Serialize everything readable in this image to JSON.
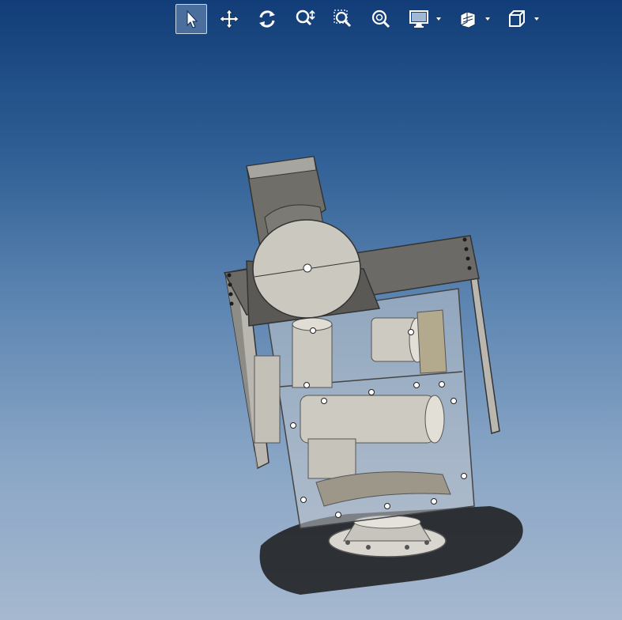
{
  "toolbar": {
    "items": [
      {
        "icon": "select-arrow-icon",
        "active": true
      },
      {
        "icon": "pan-icon"
      },
      {
        "icon": "rotate-icon"
      },
      {
        "icon": "zoom-in-out-icon"
      },
      {
        "icon": "zoom-to-area-icon"
      },
      {
        "icon": "zoom-to-fit-icon"
      },
      {
        "icon": "display-style-icon",
        "dropdown": true
      },
      {
        "icon": "section-view-icon",
        "dropdown": true
      },
      {
        "icon": "view-orientation-cube-icon",
        "dropdown": true
      }
    ]
  },
  "viewport": {
    "background_top": "#123d78",
    "background_bottom": "#a6b8cf",
    "model_color": "#c9c6bd",
    "frame_color": "#6b6a66"
  }
}
